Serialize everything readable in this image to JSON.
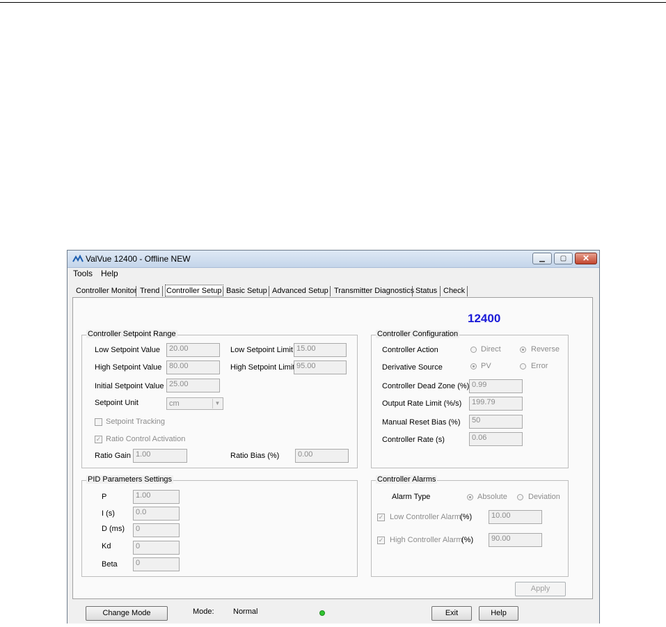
{
  "window": {
    "title": "ValVue 12400 - Offline  NEW"
  },
  "menu": [
    "Tools",
    "Help"
  ],
  "tabs": [
    "Controller Monitor",
    "Trend",
    "Controller Setup",
    "Basic Setup",
    "Advanced Setup",
    "Transmitter Diagnostics",
    "Status",
    "Check"
  ],
  "active_tab": "Controller Setup",
  "device_number": "12400",
  "setpoint_range": {
    "title": "Controller Setpoint Range",
    "low_value_label": "Low Setpoint Value",
    "low_value": "20.00",
    "high_value_label": "High Setpoint Value",
    "high_value": "80.00",
    "initial_value_label": "Initial Setpoint Value",
    "initial_value": "25.00",
    "unit_label": "Setpoint Unit",
    "unit": "cm",
    "low_limit_label": "Low Setpoint Limit",
    "low_limit": "15.00",
    "high_limit_label": "High Setpoint Limit",
    "high_limit": "95.00",
    "tracking_label": "Setpoint Tracking",
    "tracking_checked": false,
    "ratio_activation_label": "Ratio Control Activation",
    "ratio_activation_checked": true,
    "ratio_gain_label": "Ratio Gain",
    "ratio_gain": "1.00",
    "ratio_bias_label": "Ratio Bias  (%)",
    "ratio_bias": "0.00"
  },
  "configuration": {
    "title": "Controller Configuration",
    "action_label": "Controller Action",
    "action_direct": "Direct",
    "action_reverse": "Reverse",
    "action_selected": "Reverse",
    "derivative_label": "Derivative Source",
    "deriv_pv": "PV",
    "deriv_error": "Error",
    "deriv_selected": "PV",
    "dead_zone_label": "Controller Dead Zone (%)",
    "dead_zone": "0.99",
    "rate_limit_label": "Output Rate Limit (%/s)",
    "rate_limit": "199.79",
    "reset_bias_label": "Manual Reset Bias (%)",
    "reset_bias": "50",
    "rate_label": "Controller Rate (s)",
    "rate": "0.06"
  },
  "pid": {
    "title": "PID Parameters Settings",
    "p_label": "P",
    "p": "1.00",
    "i_label": "I  (s)",
    "i": "0.0",
    "d_label": "D (ms)",
    "d": "0",
    "kd_label": "Kd",
    "kd": "0",
    "beta_label": "Beta",
    "beta": "0"
  },
  "alarms": {
    "title": "Controller Alarms",
    "type_label": "Alarm Type",
    "absolute": "Absolute",
    "deviation": "Deviation",
    "type_selected": "Absolute",
    "low_label": "Low Controller Alarm",
    "low_unit": "(%)",
    "low_value": "10.00",
    "low_checked": true,
    "high_label": "High Controller Alarm",
    "high_unit": "(%)",
    "high_value": "90.00",
    "high_checked": true
  },
  "buttons": {
    "apply": "Apply",
    "change_mode": "Change Mode",
    "exit": "Exit",
    "help": "Help"
  },
  "status": {
    "mode_label": "Mode:",
    "mode_value": "Normal",
    "led_color": "#31c431"
  }
}
